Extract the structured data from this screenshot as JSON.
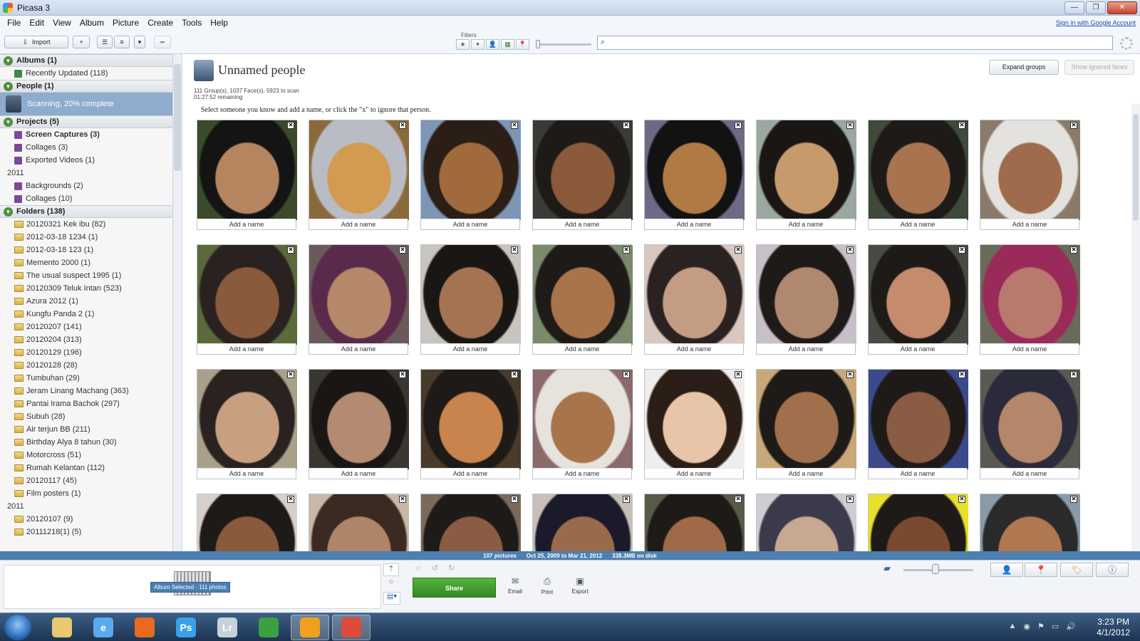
{
  "window": {
    "title": "Picasa 3",
    "buttons": [
      "—",
      "❐",
      "✕"
    ]
  },
  "menu": {
    "items": [
      "File",
      "Edit",
      "View",
      "Album",
      "Picture",
      "Create",
      "Tools",
      "Help"
    ],
    "signin": "Sign in with Google Account"
  },
  "toolbar": {
    "import_label": "Import",
    "filters_label": "Filters",
    "filter_icons": [
      "★",
      "✦",
      "👤",
      "▦",
      "📍"
    ],
    "search_placeholder": ""
  },
  "sidebar": {
    "albums": {
      "label": "Albums (1)",
      "items": [
        "Recently Updated (118)"
      ]
    },
    "people": {
      "label": "People (1)",
      "scanning": "Scanning, 20% complete"
    },
    "projects": {
      "label": "Projects (5)",
      "items": [
        "Screen Captures (3)",
        "Collages (3)",
        "Exported Videos (1)"
      ],
      "year": "2011",
      "items2": [
        "Backgrounds (2)",
        "Collages (10)"
      ]
    },
    "folders": {
      "label": "Folders (138)",
      "items": [
        "20120321 Kek ibu (82)",
        "2012-03-18 1234 (1)",
        "2012-03-18 123 (1)",
        "Memento 2000 (1)",
        "The usual suspect 1995 (1)",
        "20120309 Teluk Intan (523)",
        "Azura 2012 (1)",
        "Kungfu Panda 2 (1)",
        "20120207 (141)",
        "20120204 (313)",
        "20120129 (196)",
        "20120128 (28)",
        "Tumbuhan (29)",
        "Jeram Linang Machang (363)",
        "Pantai Irama Bachok (297)",
        "Subuh (28)",
        "Air terjun BB (211)",
        "Birthday Alya 8 tahun (30)",
        "Motorcross (51)",
        "Rumah Kelantan (112)",
        "20120117 (45)",
        "Film posters (1)"
      ],
      "year": "2011",
      "items2": [
        "20120107 (9)",
        "20111218(1) (5)"
      ]
    }
  },
  "main": {
    "title": "Unnamed people",
    "meta1": "111 Group(s), 1037 Face(s), 5923 to scan",
    "meta2": "01:27:52 remaining",
    "instruction": "Select someone you know and add a name, or click the \"x\" to ignore that person.",
    "expand_label": "Expand groups",
    "ignored_label": "Show ignored faces",
    "add_name": "Add a name",
    "close_glyph": "✕"
  },
  "faces": [
    {
      "skin": "#b58560",
      "cover": "#141414",
      "bg": "#3a4a2a"
    },
    {
      "skin": "#d39a52",
      "cover": "#b9bcc4",
      "bg": "#8a6a3a"
    },
    {
      "skin": "#a06a3c",
      "cover": "#2a1e16",
      "bg": "#7d96b6"
    },
    {
      "skin": "#8a5a3a",
      "cover": "#1e1a18",
      "bg": "#3c3a36"
    },
    {
      "skin": "#b07a44",
      "cover": "#121212",
      "bg": "#6c6a86"
    },
    {
      "skin": "#c69a6c",
      "cover": "#1a1614",
      "bg": "#9aa8a0"
    },
    {
      "skin": "#a87450",
      "cover": "#1e1a18",
      "bg": "#3e4a3a"
    },
    {
      "skin": "#9e6c4c",
      "cover": "#e4e2de",
      "bg": "#8a7a6a"
    },
    {
      "skin": "#8a5a3c",
      "cover": "#2a2220",
      "bg": "#5a6a3a"
    },
    {
      "skin": "#b48868",
      "cover": "#5a2a4a",
      "bg": "#6a5a5a"
    },
    {
      "skin": "#a47452",
      "cover": "#1a1614",
      "bg": "#c8c4c0"
    },
    {
      "skin": "#a8744c",
      "cover": "#1e1a18",
      "bg": "#7a8a6a"
    },
    {
      "skin": "#c49c84",
      "cover": "#2a2220",
      "bg": "#d8c8c0"
    },
    {
      "skin": "#b08870",
      "cover": "#1e1a18",
      "bg": "#c8c0c8"
    },
    {
      "skin": "#c48c6c",
      "cover": "#1e1a18",
      "bg": "#4a4a44"
    },
    {
      "skin": "#b87a6c",
      "cover": "#9a2a5a",
      "bg": "#6a6a5a"
    },
    {
      "skin": "#c8a080",
      "cover": "#2a2220",
      "bg": "#a8a088"
    },
    {
      "skin": "#b48a70",
      "cover": "#1a1614",
      "bg": "#3a3632"
    },
    {
      "skin": "#c8844c",
      "cover": "#1e1a18",
      "bg": "#4a3a2a"
    },
    {
      "skin": "#a8744c",
      "cover": "#e6e2dc",
      "bg": "#8a6a6a"
    },
    {
      "skin": "#e8c4a8",
      "cover": "#2a1e16",
      "bg": "#f0eeec"
    },
    {
      "skin": "#a0704c",
      "cover": "#1e1a18",
      "bg": "#c8a878"
    },
    {
      "skin": "#8a5c44",
      "cover": "#1e1a18",
      "bg": "#3a4a8a"
    },
    {
      "skin": "#b4866a",
      "cover": "#2a2a3a",
      "bg": "#5a5a52"
    },
    {
      "skin": "#8a5a3c",
      "cover": "#1e1a18",
      "bg": "#d8d0c8"
    },
    {
      "skin": "#b08468",
      "cover": "#3a2a22",
      "bg": "#c8b8a8"
    },
    {
      "skin": "#8a5c44",
      "cover": "#1e1a18",
      "bg": "#7a6a5a"
    },
    {
      "skin": "#9a6a4c",
      "cover": "#1a1a2a",
      "bg": "#c8c0b8"
    },
    {
      "skin": "#a06a48",
      "cover": "#1e1a18",
      "bg": "#5a5a4a"
    },
    {
      "skin": "#c8a890",
      "cover": "#3a3a4a",
      "bg": "#d0ccd4"
    },
    {
      "skin": "#7a4a30",
      "cover": "#1e1a18",
      "bg": "#e8e02a"
    },
    {
      "skin": "#b07850",
      "cover": "#2a2a2a",
      "bg": "#8a9aa8"
    }
  ],
  "status": {
    "pictures": "107 pictures",
    "range": "Oct 25, 2009 to Mar 21, 2012",
    "disk": "338.3MB on disk"
  },
  "tray": {
    "badge": "Album Selected - 111 photos",
    "share": "Share",
    "email": "Email",
    "print": "Print",
    "export": "Export",
    "zoom_level": 0.45
  },
  "taskbar": {
    "apps": [
      {
        "label": "",
        "color": "#e8c870"
      },
      {
        "label": "e",
        "color": "#5aaaf0"
      },
      {
        "label": "",
        "color": "#e86a20"
      },
      {
        "label": "Ps",
        "color": "#3aa0e8"
      },
      {
        "label": "Lr",
        "color": "#c8d0d8"
      },
      {
        "label": "",
        "color": "#3aa040"
      },
      {
        "label": "",
        "color": "#f0a020"
      },
      {
        "label": "",
        "color": "#e04a3a"
      }
    ],
    "time": "3:23 PM",
    "date": "4/1/2012"
  }
}
